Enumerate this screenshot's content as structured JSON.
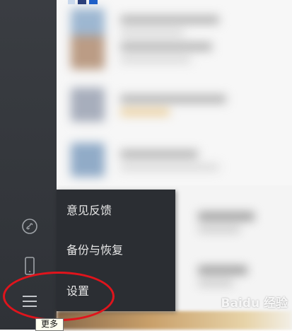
{
  "menu": {
    "items": [
      {
        "label": "意见反馈"
      },
      {
        "label": "备份与恢复"
      },
      {
        "label": "设置"
      }
    ]
  },
  "tooltip": {
    "text": "更多"
  },
  "watermark": {
    "text": "Baidu 经验"
  },
  "sidebar": {
    "icons": [
      "miniprogram-icon",
      "phone-icon",
      "more-menu-icon"
    ]
  },
  "colors": {
    "sidebar_bg": "#2f3237",
    "menu_bg": "#2b2e33",
    "menu_text": "#e7e7e7",
    "annotation": "#e0141c"
  }
}
